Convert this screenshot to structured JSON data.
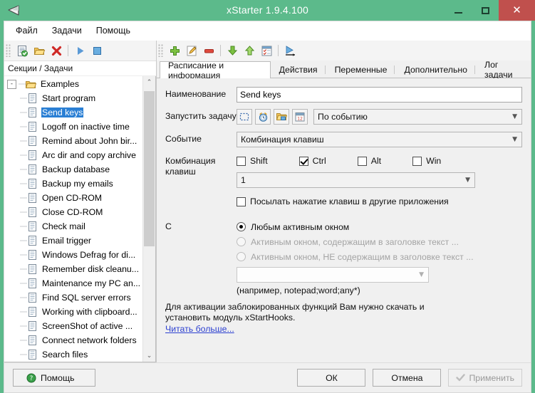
{
  "window": {
    "title": "xStarter 1.9.4.100",
    "app_icon": "flag-icon",
    "minimize_label": "–",
    "maximize_label": "□",
    "close_label": "✕",
    "titlebar_color": "#5cba8b",
    "close_color": "#c0504d"
  },
  "menu": {
    "items": [
      {
        "label": "Файл",
        "name": "menu-file"
      },
      {
        "label": "Задачи",
        "name": "menu-tasks"
      },
      {
        "label": "Помощь",
        "name": "menu-help"
      }
    ]
  },
  "left_toolbar": {
    "buttons": [
      {
        "name": "new-task-button",
        "icon": "new-document-icon"
      },
      {
        "name": "open-folder-button",
        "icon": "folder-icon"
      },
      {
        "name": "delete-button",
        "icon": "red-x-icon"
      },
      {
        "name": "run-button",
        "icon": "play-icon"
      },
      {
        "name": "stop-button",
        "icon": "stop-icon"
      }
    ]
  },
  "right_toolbar": {
    "buttons": [
      {
        "name": "add-action-button",
        "icon": "green-plus-icon"
      },
      {
        "name": "edit-action-button",
        "icon": "edit-pencil-icon"
      },
      {
        "name": "remove-action-button",
        "icon": "red-minus-icon"
      },
      {
        "name": "move-down-button",
        "icon": "green-down-arrow-icon"
      },
      {
        "name": "move-up-button",
        "icon": "green-up-arrow-icon"
      },
      {
        "name": "properties-button",
        "icon": "checklist-icon"
      },
      {
        "name": "run-task-button",
        "icon": "play-arrow-icon"
      }
    ]
  },
  "tree": {
    "header": "Секции / Задачи",
    "root": {
      "label": "Examples",
      "expander": "-",
      "icon": "folder-icon"
    },
    "items": [
      {
        "label": "Start program"
      },
      {
        "label": "Send keys",
        "selected": true
      },
      {
        "label": "Logoff on inactive time"
      },
      {
        "label": "Remind about John bir..."
      },
      {
        "label": "Arc dir and copy archive"
      },
      {
        "label": "Backup database"
      },
      {
        "label": "Backup my emails"
      },
      {
        "label": "Open CD-ROM"
      },
      {
        "label": "Close CD-ROM"
      },
      {
        "label": "Check mail"
      },
      {
        "label": "Email trigger"
      },
      {
        "label": "Windows Defrag for di..."
      },
      {
        "label": "Remember disk cleanu..."
      },
      {
        "label": "Maintenance my PC an..."
      },
      {
        "label": "Find SQL server errors"
      },
      {
        "label": "Working with clipboard..."
      },
      {
        "label": "ScreenShot of active ..."
      },
      {
        "label": "Connect network folders"
      },
      {
        "label": "Search files"
      }
    ],
    "scroll_up": "⌃",
    "scroll_down": "⌄"
  },
  "tabs": [
    {
      "label": "Расписание и информация",
      "active": true,
      "name": "tab-schedule-info"
    },
    {
      "label": "Действия",
      "active": false,
      "name": "tab-actions"
    },
    {
      "label": "Переменные",
      "active": false,
      "name": "tab-variables"
    },
    {
      "label": "Дополнительно",
      "active": false,
      "name": "tab-advanced"
    },
    {
      "label": "Лог задачи",
      "active": false,
      "name": "tab-task-log"
    }
  ],
  "form": {
    "name_label": "Наименование",
    "name_value": "Send keys",
    "name_placeholder": "",
    "run_task_label": "Запустить задачу",
    "run_mode_buttons": [
      {
        "name": "trigger-none-button",
        "icon": "dotted-rect-icon"
      },
      {
        "name": "trigger-timer-button",
        "icon": "alarm-clock-icon"
      },
      {
        "name": "trigger-folder-button",
        "icon": "folder-watch-icon"
      },
      {
        "name": "trigger-calendar-button",
        "icon": "calendar-icon"
      }
    ],
    "run_mode_value": "По событию",
    "event_label": "Событие",
    "event_value": "Комбинация клавиш",
    "hotkey_label": "Комбинация\nклавиш",
    "hotkey_label_line1": "Комбинация",
    "hotkey_label_line2": "клавиш",
    "modifiers": [
      {
        "label": "Shift",
        "checked": false,
        "name": "checkbox-shift"
      },
      {
        "label": "Ctrl",
        "checked": true,
        "name": "checkbox-ctrl"
      },
      {
        "label": "Alt",
        "checked": false,
        "name": "checkbox-alt"
      },
      {
        "label": "Win",
        "checked": false,
        "name": "checkbox-win"
      }
    ],
    "key_value": "1",
    "send_keys_checkbox": {
      "label": "Посылать нажатие клавиш в другие приложения",
      "checked": false
    },
    "with_label": "С",
    "window_options": [
      {
        "label": "Любым активным окном",
        "selected": true,
        "disabled": false
      },
      {
        "label": "Активным окном, содержащим в заголовке текст ...",
        "selected": false,
        "disabled": true
      },
      {
        "label": "Активным окном, НЕ содержащим в заголовке текст ...",
        "selected": false,
        "disabled": true
      }
    ],
    "window_filter_value": "",
    "window_filter_hint": "(например, notepad;word;any*)",
    "note_line1": "Для активации заблокированных функций Вам нужно скачать и",
    "note_line2": "установить модуль xStartHooks.",
    "note_link": "Читать больше..."
  },
  "footer": {
    "help_label": "Помощь",
    "ok_label": "ОК",
    "cancel_label": "Отмена",
    "apply_label": "Применить",
    "apply_disabled": true
  }
}
